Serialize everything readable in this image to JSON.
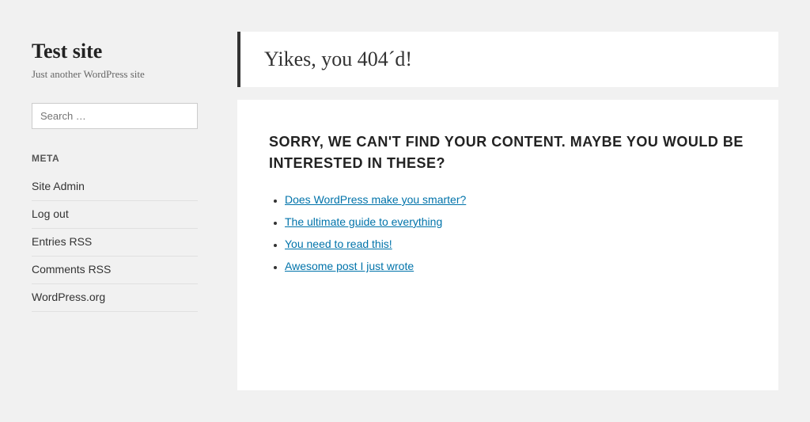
{
  "sidebar": {
    "site_title": "Test site",
    "site_tagline": "Just another WordPress site",
    "search": {
      "placeholder": "Search …"
    },
    "meta_section_title": "META",
    "meta_links": [
      {
        "label": "Site Admin",
        "href": "#"
      },
      {
        "label": "Log out",
        "href": "#"
      },
      {
        "label": "Entries RSS",
        "href": "#"
      },
      {
        "label": "Comments RSS",
        "href": "#"
      },
      {
        "label": "WordPress.org",
        "href": "#"
      }
    ]
  },
  "header": {
    "title": "Yikes, you 404´d!"
  },
  "content": {
    "sorry_heading": "SORRY, WE CAN'T FIND YOUR CONTENT. MAYBE YOU WOULD BE INTERESTED IN THESE?",
    "suggestions": [
      {
        "label": "Does WordPress make you smarter?",
        "href": "#"
      },
      {
        "label": "The ultimate guide to everything",
        "href": "#"
      },
      {
        "label": "You need to read this!",
        "href": "#"
      },
      {
        "label": "Awesome post I just wrote",
        "href": "#"
      }
    ]
  }
}
